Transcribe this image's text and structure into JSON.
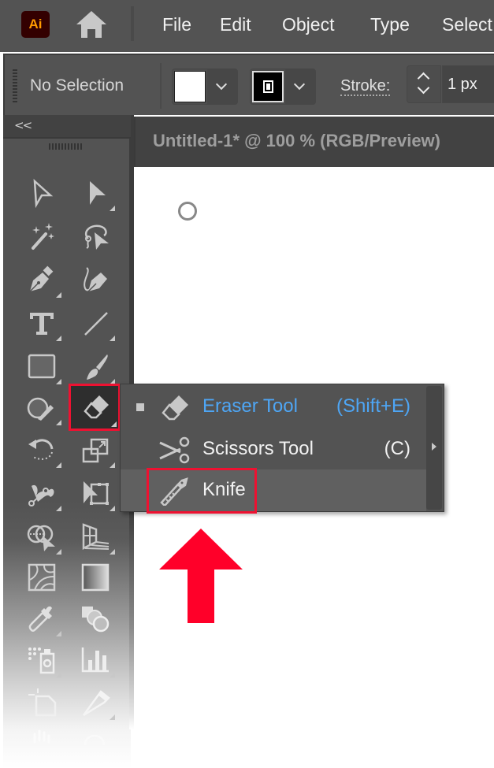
{
  "app": {
    "logo_text": "Ai",
    "logo_bg": "#330000",
    "logo_fg": "#ff9a00",
    "home_icon": "home-icon"
  },
  "menu": {
    "items": [
      "File",
      "Edit",
      "Object",
      "Type",
      "Select"
    ]
  },
  "control_bar": {
    "selection_status": "No Selection",
    "fill_color": "#ffffff",
    "stroke_color": "#000000",
    "stroke_label": "Stroke:",
    "stroke_value": "1 px"
  },
  "tool_panel": {
    "collapse_label": "<<",
    "tools": [
      {
        "name": "selection-tool",
        "has_flyout": false
      },
      {
        "name": "direct-selection-tool",
        "has_flyout": true
      },
      {
        "name": "magic-wand-tool",
        "has_flyout": false
      },
      {
        "name": "lasso-tool",
        "has_flyout": false
      },
      {
        "name": "pen-tool",
        "has_flyout": true
      },
      {
        "name": "curvature-tool",
        "has_flyout": false
      },
      {
        "name": "type-tool",
        "has_flyout": true
      },
      {
        "name": "line-segment-tool",
        "has_flyout": true
      },
      {
        "name": "rectangle-tool",
        "has_flyout": true
      },
      {
        "name": "paintbrush-tool",
        "has_flyout": true
      },
      {
        "name": "shaper-tool",
        "has_flyout": true
      },
      {
        "name": "eraser-tool",
        "has_flyout": true,
        "active": true
      },
      {
        "name": "rotate-tool",
        "has_flyout": true
      },
      {
        "name": "scale-tool",
        "has_flyout": true
      },
      {
        "name": "puppet-warp-tool",
        "has_flyout": true
      },
      {
        "name": "free-transform-tool",
        "has_flyout": true
      },
      {
        "name": "shape-builder-tool",
        "has_flyout": true
      },
      {
        "name": "perspective-grid-tool",
        "has_flyout": true
      },
      {
        "name": "mesh-tool",
        "has_flyout": false
      },
      {
        "name": "gradient-tool",
        "has_flyout": false
      },
      {
        "name": "eyedropper-tool",
        "has_flyout": true
      },
      {
        "name": "blend-tool",
        "has_flyout": false
      },
      {
        "name": "symbol-sprayer-tool",
        "has_flyout": true
      },
      {
        "name": "column-graph-tool",
        "has_flyout": true
      },
      {
        "name": "artboard-tool",
        "has_flyout": false
      },
      {
        "name": "slice-tool",
        "has_flyout": true
      },
      {
        "name": "hand-tool",
        "has_flyout": false
      },
      {
        "name": "zoom-tool",
        "has_flyout": false
      }
    ]
  },
  "document": {
    "tab_title": "Untitled-1* @ 100 % (RGB/Preview)"
  },
  "flyout": {
    "items": [
      {
        "label": "Eraser Tool",
        "shortcut": "(Shift+E)",
        "icon": "eraser-icon",
        "selected": true
      },
      {
        "label": "Scissors Tool",
        "shortcut": "(C)",
        "icon": "scissors-icon",
        "selected": false
      },
      {
        "label": "Knife",
        "shortcut": "",
        "icon": "knife-icon",
        "selected": false,
        "hover": true
      }
    ],
    "selected_color": "#4ea6f5"
  },
  "annotation": {
    "highlight_color": "#ee1131",
    "arrow_direction": "up"
  }
}
